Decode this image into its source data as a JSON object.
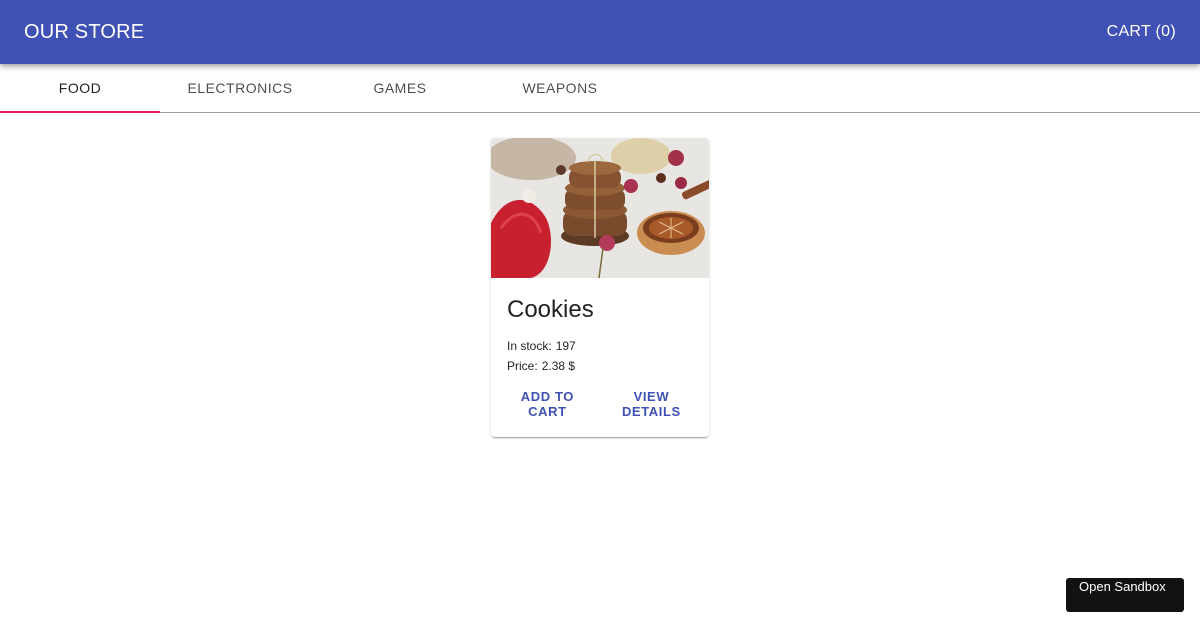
{
  "header": {
    "title": "OUR STORE",
    "cart_label": "CART (0)"
  },
  "tabs": [
    {
      "label": "FOOD",
      "active": true
    },
    {
      "label": "ELECTRONICS",
      "active": false
    },
    {
      "label": "GAMES",
      "active": false
    },
    {
      "label": "WEAPONS",
      "active": false
    }
  ],
  "product": {
    "name": "Cookies",
    "stock_label": "In stock:",
    "stock": "197",
    "price_label": "Price:",
    "price": "2.38 $",
    "add_to_cart": "ADD TO CART",
    "view_details": "VIEW DETAILS"
  },
  "sandbox": {
    "label": "Open Sandbox"
  },
  "colors": {
    "primary": "#3f51b5",
    "tab_indicator": "#e91e63"
  }
}
